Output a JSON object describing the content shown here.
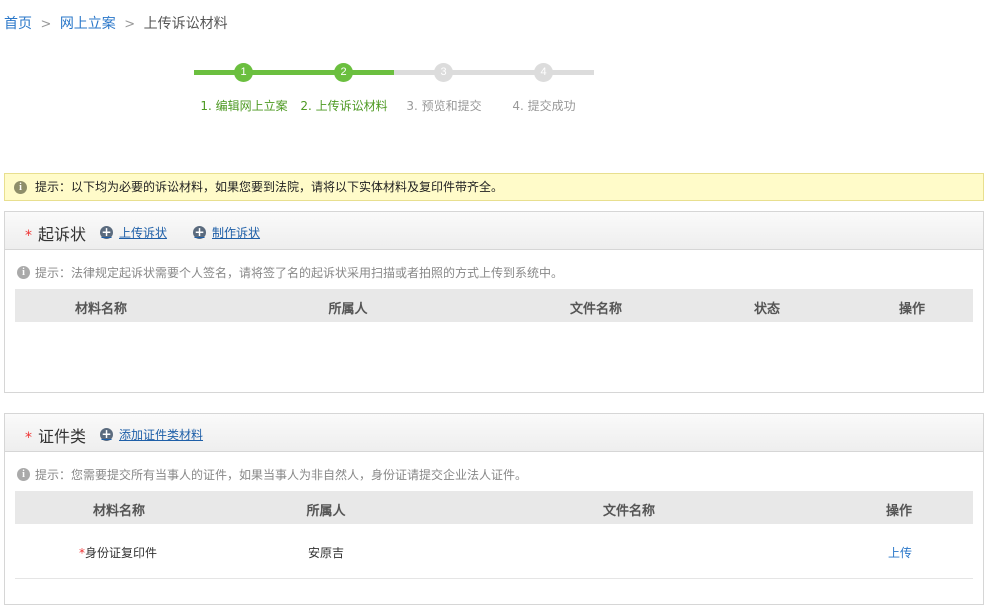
{
  "breadcrumb": {
    "home": "首页",
    "online_filing": "网上立案",
    "current": "上传诉讼材料"
  },
  "steps": [
    {
      "num": "1",
      "label": "1. 编辑网上立案",
      "state": "done"
    },
    {
      "num": "2",
      "label": "2. 上传诉讼材料",
      "state": "done"
    },
    {
      "num": "3",
      "label": "3. 预览和提交",
      "state": "todo"
    },
    {
      "num": "4",
      "label": "4. 提交成功",
      "state": "todo"
    }
  ],
  "notice": {
    "icon": "i",
    "text": "提示：以下均为必要的诉讼材料，如果您要到法院，请将以下实体材料及复印件带齐全。"
  },
  "complaint": {
    "star": "*",
    "title": "起诉状",
    "upload_label": "上传诉状",
    "make_label": "制作诉状",
    "hint": "提示：法律规定起诉状需要个人签名，请将签了名的起诉状采用扫描或者拍照的方式上传到系统中。",
    "columns": [
      "材料名称",
      "所属人",
      "文件名称",
      "状态",
      "操作"
    ]
  },
  "certificates": {
    "star": "*",
    "title": "证件类",
    "add_label": "添加证件类材料",
    "hint": "提示：您需要提交所有当事人的证件，如果当事人为非自然人，身份证请提交企业法人证件。",
    "columns": [
      "材料名称",
      "所属人",
      "文件名称",
      "操作"
    ],
    "rows": [
      {
        "required": "*",
        "name": "身份证复印件",
        "owner": "安原吉",
        "file": "",
        "action": "上传"
      }
    ]
  },
  "colors": {
    "accent_green": "#6bbf3f",
    "link_blue": "#2a77c9",
    "required_red": "#e33333",
    "notice_bg": "#fffbc9"
  }
}
